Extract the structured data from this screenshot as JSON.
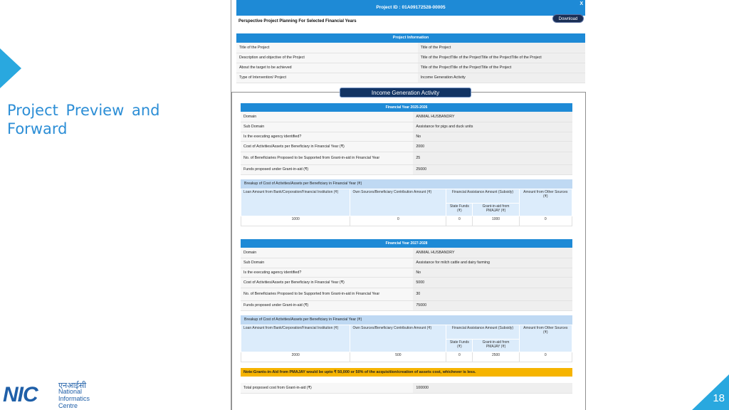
{
  "slide": {
    "title": "Project Preview and Forward",
    "page_number": "18",
    "logo": {
      "mark": "NIC",
      "hindi": "एनआईसी",
      "line1": "National",
      "line2": "Informatics",
      "line3": "Centre"
    }
  },
  "screenshot": {
    "project_id": "Project ID : 01A09172528-00005",
    "close_label": "X",
    "perspective_title": "Perspective Project Planning For Selected Financial Years",
    "download_label": "Download",
    "project_info": {
      "header": "Project Information",
      "rows": [
        {
          "k": "Title of the Project",
          "v": "Title of the Project"
        },
        {
          "k": "Description and objective of the Project",
          "v": "Title of the ProjectTitle of the ProjectTitle of the ProjectTitle of the Project"
        },
        {
          "k": "About the target to be achieved",
          "v": "Title of the ProjectTitle of the ProjectTitle of the Project"
        },
        {
          "k": "Type of Intervention/ Project",
          "v": "Income Generation Activity"
        }
      ]
    },
    "activity_label": "Income Generation Activity",
    "years": [
      {
        "header": "Financial Year 2025-2026",
        "rows": [
          {
            "k": "Domain",
            "v": "ANIMAL HUSBANDRY"
          },
          {
            "k": "Sub Domain",
            "v": "Assistance for pigs and duck units"
          },
          {
            "k": "Is the executing agency identified?",
            "v": "No"
          },
          {
            "k": "Cost of Activities/Assets per Beneficiary in Financial Year (₹)",
            "v": "2000"
          },
          {
            "k": "No. of Beneficiaries Proposed to be Supported from Grant-in-aid in Financial Year",
            "v": "25"
          },
          {
            "k": "Funds proposed under Grant-in-aid (₹)",
            "v": "25000"
          }
        ],
        "breakup": {
          "header": "Breakup of Cost of Activities/Assets per Beneficiary in Financial Year (₹)",
          "col_loan": "Loan Amount from Bank/Corporation/Financial Institution (₹)",
          "col_own": "Own Sources/Beneficiary Contribution Amount (₹)",
          "col_fin": "Financial Assistance Amount (Subsidy)",
          "col_state": "State Funds (₹)",
          "col_pmajay": "Grant-in-aid from PMAJAY (₹)",
          "col_other": "Amount from Other Sources (₹)",
          "values": {
            "loan": "1000",
            "own": "0",
            "state": "0",
            "pmajay": "1000",
            "other": "0"
          }
        }
      },
      {
        "header": "Financial Year 2027-2028",
        "rows": [
          {
            "k": "Domain",
            "v": "ANIMAL HUSBANDRY"
          },
          {
            "k": "Sub Domain",
            "v": "Assistance for milch cattle and dairy farming"
          },
          {
            "k": "Is the executing agency identified?",
            "v": "No"
          },
          {
            "k": "Cost of Activities/Assets per Beneficiary in Financial Year (₹)",
            "v": "5000"
          },
          {
            "k": "No. of Beneficiaries Proposed to be Supported from Grant-in-aid in Financial Year",
            "v": "30"
          },
          {
            "k": "Funds proposed under Grant-in-aid (₹)",
            "v": "75000"
          }
        ],
        "breakup": {
          "header": "Breakup of Cost of Activities/Assets per Beneficiary in Financial Year (₹)",
          "col_loan": "Loan Amount from Bank/Corporation/Financial Institution (₹)",
          "col_own": "Own Sources/Beneficiary Contribution Amount (₹)",
          "col_fin": "Financial Assistance Amount (Subsidy)",
          "col_state": "State Funds (₹)",
          "col_pmajay": "Grant-in-aid from PMAJAY (₹)",
          "col_other": "Amount from Other Sources (₹)",
          "values": {
            "loan": "2000",
            "own": "500",
            "state": "0",
            "pmajay": "2500",
            "other": "0"
          }
        }
      }
    ],
    "note": "Note:Grants-in-Aid from PMAJAY would be upto ₹ 50,000 or 50% of the acquisition/creation of assets cost, whichever is less.",
    "total": {
      "k": "Total proposed cost from Grant-in-aid (₹)",
      "v": "100000"
    }
  }
}
